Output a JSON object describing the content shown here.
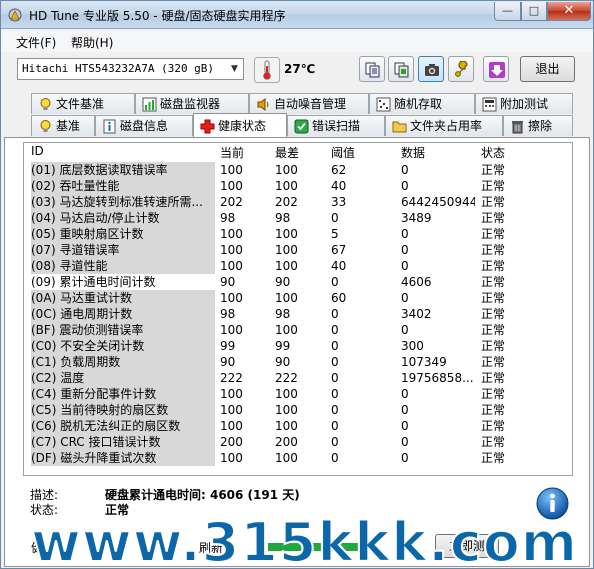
{
  "window": {
    "title": "HD Tune 专业版 5.50 - 硬盘/固态硬盘实用程序",
    "minimize": "—",
    "maximize": "□",
    "close": "✕"
  },
  "menu": {
    "file": "文件(F)",
    "help": "帮助(H)"
  },
  "toolbar": {
    "drive": "Hitachi HTS543232A7A (320 gB)",
    "temperature": "27℃",
    "exit_label": "退出",
    "icons": [
      "copy-icon",
      "copy-all-icon",
      "screenshot-icon",
      "options-icon",
      "save-icon"
    ]
  },
  "tabs_row1": [
    "文件基准",
    "磁盘监视器",
    "自动噪音管理",
    "随机存取",
    "附加测试"
  ],
  "tabs_row2": [
    "基准",
    "磁盘信息",
    "健康状态",
    "错误扫描",
    "文件夹占用率",
    "擦除"
  ],
  "active_tab": "健康状态",
  "table": {
    "headers": {
      "id": "ID",
      "current": "当前",
      "worst": "最差",
      "threshold": "阈值",
      "data": "数据",
      "status": "状态"
    },
    "rows": [
      {
        "id": "(01) 底层数据读取错误率",
        "current": "100",
        "worst": "100",
        "threshold": "62",
        "data": "0",
        "status": "正常"
      },
      {
        "id": "(02) 吞吐量性能",
        "current": "100",
        "worst": "100",
        "threshold": "40",
        "data": "0",
        "status": "正常"
      },
      {
        "id": "(03) 马达旋转到标准转速所需...",
        "current": "202",
        "worst": "202",
        "threshold": "33",
        "data": "64424509441",
        "status": "正常"
      },
      {
        "id": "(04) 马达启动/停止计数",
        "current": "98",
        "worst": "98",
        "threshold": "0",
        "data": "3489",
        "status": "正常"
      },
      {
        "id": "(05) 重映射扇区计数",
        "current": "100",
        "worst": "100",
        "threshold": "5",
        "data": "0",
        "status": "正常"
      },
      {
        "id": "(07) 寻道错误率",
        "current": "100",
        "worst": "100",
        "threshold": "67",
        "data": "0",
        "status": "正常"
      },
      {
        "id": "(08) 寻道性能",
        "current": "100",
        "worst": "100",
        "threshold": "40",
        "data": "0",
        "status": "正常"
      },
      {
        "id": "(09) 累计通电时间计数",
        "current": "90",
        "worst": "90",
        "threshold": "0",
        "data": "4606",
        "status": "正常"
      },
      {
        "id": "(0A) 马达重试计数",
        "current": "100",
        "worst": "100",
        "threshold": "60",
        "data": "0",
        "status": "正常"
      },
      {
        "id": "(0C) 通电周期计数",
        "current": "98",
        "worst": "98",
        "threshold": "0",
        "data": "3402",
        "status": "正常"
      },
      {
        "id": "(BF) 震动侦测错误率",
        "current": "100",
        "worst": "100",
        "threshold": "0",
        "data": "0",
        "status": "正常"
      },
      {
        "id": "(C0) 不安全关闭计数",
        "current": "99",
        "worst": "99",
        "threshold": "0",
        "data": "300",
        "status": "正常"
      },
      {
        "id": "(C1) 负载周期数",
        "current": "90",
        "worst": "90",
        "threshold": "0",
        "data": "107349",
        "status": "正常"
      },
      {
        "id": "(C2) 温度",
        "current": "222",
        "worst": "222",
        "threshold": "0",
        "data": "19756858...",
        "status": "正常"
      },
      {
        "id": "(C4) 重新分配事件计数",
        "current": "100",
        "worst": "100",
        "threshold": "0",
        "data": "0",
        "status": "正常"
      },
      {
        "id": "(C5) 当前待映射的扇区数",
        "current": "100",
        "worst": "100",
        "threshold": "0",
        "data": "0",
        "status": "正常"
      },
      {
        "id": "(C6) 脱机无法纠正的扇区数",
        "current": "100",
        "worst": "100",
        "threshold": "0",
        "data": "0",
        "status": "正常"
      },
      {
        "id": "(C7) CRC 接口错误计数",
        "current": "200",
        "worst": "200",
        "threshold": "0",
        "data": "0",
        "status": "正常"
      },
      {
        "id": "(DF) 磁头升降重试次数",
        "current": "100",
        "worst": "100",
        "threshold": "0",
        "data": "0",
        "status": "正常"
      }
    ]
  },
  "details": {
    "desc_label": "描述:",
    "desc_value": "硬盘累计通电时间: 4606 (191 天)",
    "status_label": "状态:",
    "status_value": "正常"
  },
  "bottom": {
    "left_fragment": "健",
    "mid_fragment": "刷新",
    "start_label": "立即测"
  },
  "watermark": "www.315kkk.com",
  "colors": {
    "accent": "#0c67a8",
    "selected_row_bg": "#ffffff",
    "id_column_bg": "#d8d8d8"
  }
}
